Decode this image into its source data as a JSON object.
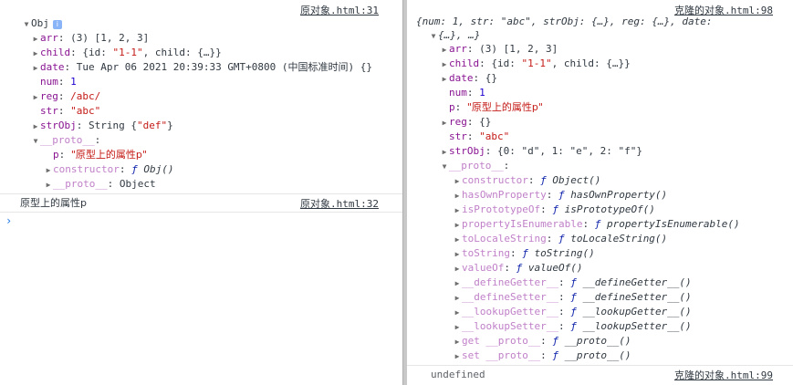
{
  "left": {
    "log1_src": "原对象.html:31",
    "obj_label": "Obj",
    "info_glyph": "i",
    "arr_key": "arr",
    "arr_val": "(3) [1, 2, 3]",
    "child_key": "child",
    "child_pre": "{id: ",
    "child_id": "\"1-1\"",
    "child_post": ", child: {…}}",
    "date_key": "date",
    "date_val": "Tue Apr 06 2021 20:39:33 GMT+0800 (中国标准时间) {}",
    "num_key": "num",
    "num_val": "1",
    "reg_key": "reg",
    "reg_val": "/abc/",
    "str_key": "str",
    "str_val": "\"abc\"",
    "strobj_key": "strObj",
    "strobj_pre": "String {",
    "strobj_str": "\"def\"",
    "strobj_post": "}",
    "proto_key": "__proto__",
    "p_key": "p",
    "p_val": "\"原型上的属性p\"",
    "ctor_key": "constructor",
    "ctor_f": "ƒ",
    "ctor_val": "Obj()",
    "proto2_key": "__proto__",
    "proto2_val": "Object",
    "log2_text": "原型上的属性p",
    "log2_src": "原对象.html:32",
    "prompt": "›"
  },
  "right": {
    "log1_src": "克隆的对象.html:98",
    "summary_line1": "{num: 1, str: \"abc\", strObj: {…}, reg: {…}, date:",
    "summary_line2": "{…}, …}",
    "arr_key": "arr",
    "arr_val": "(3) [1, 2, 3]",
    "child_key": "child",
    "child_pre": "{id: ",
    "child_id": "\"1-1\"",
    "child_post": ", child: {…}}",
    "date_key": "date",
    "date_val": "{}",
    "num_key": "num",
    "num_val": "1",
    "p_key": "p",
    "p_val": "\"原型上的属性p\"",
    "reg_key": "reg",
    "reg_val": "{}",
    "str_key": "str",
    "str_val": "\"abc\"",
    "strobj_key": "strObj",
    "strobj_val": "{0: \"d\", 1: \"e\", 2: \"f\"}",
    "proto_key": "__proto__",
    "f": "ƒ",
    "proto_items": [
      {
        "key": "constructor",
        "val": "Object()"
      },
      {
        "key": "hasOwnProperty",
        "val": "hasOwnProperty()"
      },
      {
        "key": "isPrototypeOf",
        "val": "isPrototypeOf()"
      },
      {
        "key": "propertyIsEnumerable",
        "val": "propertyIsEnumerable()"
      },
      {
        "key": "toLocaleString",
        "val": "toLocaleString()"
      },
      {
        "key": "toString",
        "val": "toString()"
      },
      {
        "key": "valueOf",
        "val": "valueOf()"
      },
      {
        "key": "__defineGetter__",
        "val": "__defineGetter__()"
      },
      {
        "key": "__defineSetter__",
        "val": "__defineSetter__()"
      },
      {
        "key": "__lookupGetter__",
        "val": "__lookupGetter__()"
      },
      {
        "key": "__lookupSetter__",
        "val": "__lookupSetter__()"
      },
      {
        "key": "get __proto__",
        "val": "__proto__()"
      },
      {
        "key": "set __proto__",
        "val": "__proto__()"
      }
    ],
    "undefined_text": "undefined",
    "log2_src": "克隆的对象.html:99"
  }
}
